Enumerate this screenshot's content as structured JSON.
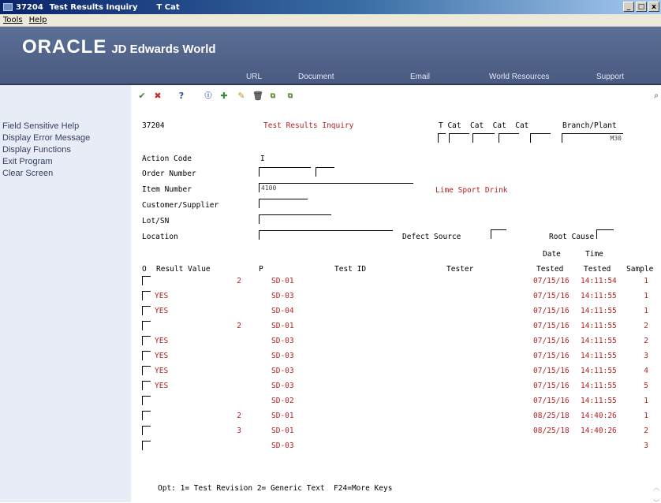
{
  "window": {
    "program_id": "37204",
    "title": "Test Results Inquiry",
    "subtitle": "T Cat",
    "controls": [
      "_",
      "□",
      "x"
    ]
  },
  "menu": [
    "Tools",
    "Help"
  ],
  "banner": {
    "oracle": "ORACLE",
    "product": "JD Edwards World",
    "nav": [
      "URL",
      "Document",
      "Email",
      "World Resources",
      "Support"
    ]
  },
  "sidebar": [
    "Field Sensitive Help",
    "Display Error Message",
    "Display Functions",
    "Exit Program",
    "Clear Screen"
  ],
  "toolbar": {
    "icons": [
      "check-icon",
      "x-icon",
      "help-icon",
      "info-icon",
      "add-icon",
      "edit-icon",
      "delete-icon",
      "copy-icon",
      "paste-icon",
      "search-icon"
    ],
    "help": "?"
  },
  "form": {
    "program_id": "37204",
    "title": "Test Results Inquiry",
    "cat_headers": "T Cat  Cat  Cat  Cat",
    "branch_plant_label": "Branch/Plant",
    "branch_plant_value": "M30",
    "labels": {
      "action_code": "Action Code",
      "order_number": "Order Number",
      "item_number": "Item Number",
      "customer_supplier": "Customer/Supplier",
      "lot_sn": "Lot/SN",
      "location": "Location",
      "defect_source": "Defect Source",
      "root_cause": "Root Cause"
    },
    "action_code_value": "I",
    "item_number_value": "4100",
    "item_description": "Lime Sport Drink"
  },
  "grid": {
    "headers": {
      "o": "O",
      "result_value": "Result Value",
      "p": "P",
      "test_id": "Test ID",
      "tester": "Tester",
      "date_top": "Date",
      "date_bottom": "Tested",
      "time_top": "Time",
      "time_bottom": "Tested",
      "sample": "Sample"
    },
    "rows": [
      {
        "result": "2",
        "p": "SD-01",
        "date": "07/15/16",
        "time": "14:11:54",
        "sample": "1"
      },
      {
        "result": "YES",
        "p": "SD-03",
        "date": "07/15/16",
        "time": "14:11:55",
        "sample": "1"
      },
      {
        "result": "YES",
        "p": "SD-04",
        "date": "07/15/16",
        "time": "14:11:55",
        "sample": "1"
      },
      {
        "result": "2",
        "p": "SD-01",
        "date": "07/15/16",
        "time": "14:11:55",
        "sample": "2"
      },
      {
        "result": "YES",
        "p": "SD-03",
        "date": "07/15/16",
        "time": "14:11:55",
        "sample": "2"
      },
      {
        "result": "YES",
        "p": "SD-03",
        "date": "07/15/16",
        "time": "14:11:55",
        "sample": "3"
      },
      {
        "result": "YES",
        "p": "SD-03",
        "date": "07/15/16",
        "time": "14:11:55",
        "sample": "4"
      },
      {
        "result": "YES",
        "p": "SD-03",
        "date": "07/15/16",
        "time": "14:11:55",
        "sample": "5"
      },
      {
        "result": "",
        "p": "SD-02",
        "date": "07/15/16",
        "time": "14:11:55",
        "sample": "1"
      },
      {
        "result": "2",
        "p": "SD-01",
        "date": "08/25/18",
        "time": "14:40:26",
        "sample": "1"
      },
      {
        "result": "3",
        "p": "SD-01",
        "date": "08/25/18",
        "time": "14:40:26",
        "sample": "2"
      },
      {
        "result": "",
        "p": "SD-03",
        "date": "",
        "time": "",
        "sample": "3"
      }
    ]
  },
  "footer": "Opt: 1= Test Revision 2= Generic Text  F24=More Keys"
}
